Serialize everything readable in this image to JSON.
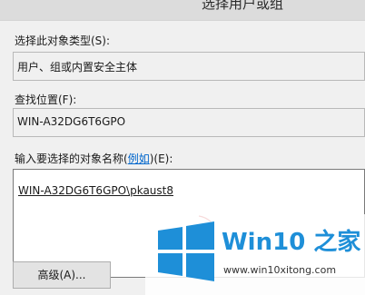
{
  "window": {
    "title": "选择用户或组"
  },
  "object_type": {
    "label": "选择此对象类型(S):",
    "value": "用户、组或内置安全主体"
  },
  "location": {
    "label": "查找位置(F):",
    "value": "WIN-A32DG6T6GPO"
  },
  "object_names": {
    "label_prefix": "输入要选择的对象名称(",
    "label_link": "例如",
    "label_suffix": ")(E):",
    "value": "WIN-A32DG6T6GPO\\pkaust8"
  },
  "buttons": {
    "advanced": "高级(A)..."
  },
  "watermark": {
    "name": "Win10 之家",
    "url": "www.win10xitong.com",
    "colors": {
      "brand": "#1e8fd8"
    }
  }
}
